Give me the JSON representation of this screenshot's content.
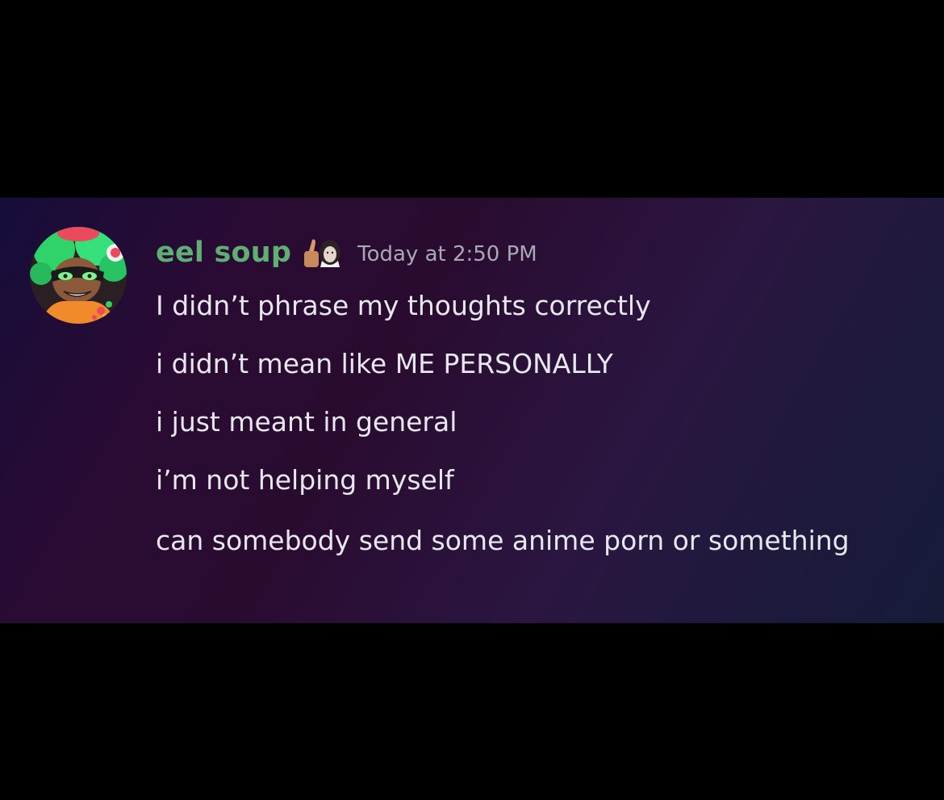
{
  "message": {
    "username": "eel soup",
    "username_color": "#5fae74",
    "badge_icon": "thumbs-up-emoji-icon",
    "timestamp": "Today at 2:50 PM",
    "lines": [
      "I didn’t phrase my thoughts correctly",
      "i didn’t mean like ME PERSONALLY",
      "i just meant in general",
      "i’m not helping myself",
      "can somebody send some anime porn or something"
    ]
  },
  "colors": {
    "background": "#000000",
    "text": "#e7e7ee",
    "timestamp": "#a7a9b6"
  }
}
